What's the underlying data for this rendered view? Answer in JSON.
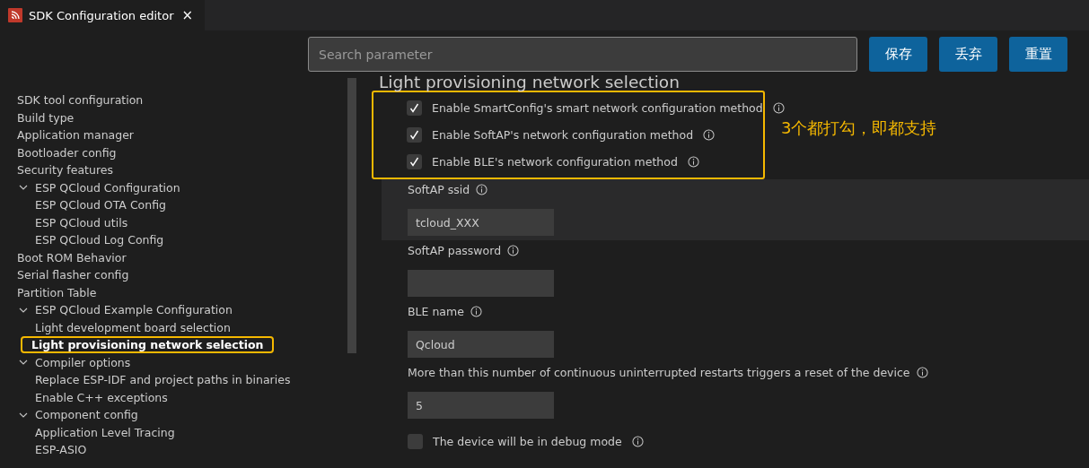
{
  "tab": {
    "title": "SDK Configuration editor",
    "close": "×",
    "selected": true
  },
  "toolbar": {
    "search": {
      "placeholder": "Search parameter"
    },
    "buttons": [
      "保存",
      "丢弃",
      "重置"
    ]
  },
  "sidebar": {
    "items": [
      {
        "label": "SDK tool configuration",
        "selected": false
      },
      {
        "label": "Build type",
        "selected": false
      },
      {
        "label": "Application manager",
        "selected": false
      },
      {
        "label": "Bootloader config",
        "selected": false
      },
      {
        "label": "Security features",
        "selected": false
      },
      {
        "label": "ESP QCloud Configuration",
        "selected": false,
        "expanded": true,
        "children": [
          {
            "label": "ESP QCloud OTA Config",
            "selected": false
          },
          {
            "label": "ESP QCloud utils",
            "selected": false
          },
          {
            "label": "ESP QCloud Log Config",
            "selected": false
          }
        ]
      },
      {
        "label": "Boot ROM Behavior",
        "selected": false
      },
      {
        "label": "Serial flasher config",
        "selected": false
      },
      {
        "label": "Partition Table",
        "selected": false
      },
      {
        "label": "ESP QCloud Example Configuration",
        "selected": false,
        "expanded": true,
        "children": [
          {
            "label": "Light development board selection",
            "selected": false
          },
          {
            "label": "Light provisioning network selection",
            "selected": true,
            "annotated": true
          }
        ]
      },
      {
        "label": "Compiler options",
        "selected": false,
        "expanded": true,
        "children": [
          {
            "label": "Replace ESP-IDF and project paths in binaries",
            "selected": false
          },
          {
            "label": "Enable C++ exceptions",
            "selected": false
          }
        ]
      },
      {
        "label": "Component config",
        "selected": false,
        "expanded": true,
        "children": [
          {
            "label": "Application Level Tracing",
            "selected": false
          },
          {
            "label": "ESP-ASIO",
            "selected": false
          }
        ]
      }
    ]
  },
  "main": {
    "heading": "Light provisioning network selection",
    "annotation": {
      "note": "3个都打勾，即都支持",
      "settings": [
        {
          "kind": "checkbox",
          "label": "Enable SmartConfig's smart network configuration method",
          "checked": true
        },
        {
          "kind": "checkbox",
          "label": "Enable SoftAP's network configuration method",
          "checked": true
        },
        {
          "kind": "checkbox",
          "label": "Enable BLE's network configuration method",
          "checked": true
        }
      ]
    },
    "settings": [
      {
        "kind": "text",
        "label": "SoftAP ssid",
        "value": "tcloud_XXX",
        "highlighted": true
      },
      {
        "kind": "text",
        "label": "SoftAP password",
        "highlighted": false
      },
      {
        "kind": "text",
        "label": "BLE name",
        "value": "Qcloud",
        "highlighted": false
      },
      {
        "kind": "text",
        "label": "More than this number of continuous uninterrupted restarts triggers a reset of the device",
        "value": "5",
        "highlighted": false
      },
      {
        "kind": "checkbox",
        "label": "The device will be in debug mode",
        "checked": false,
        "highlighted": false
      }
    ]
  }
}
